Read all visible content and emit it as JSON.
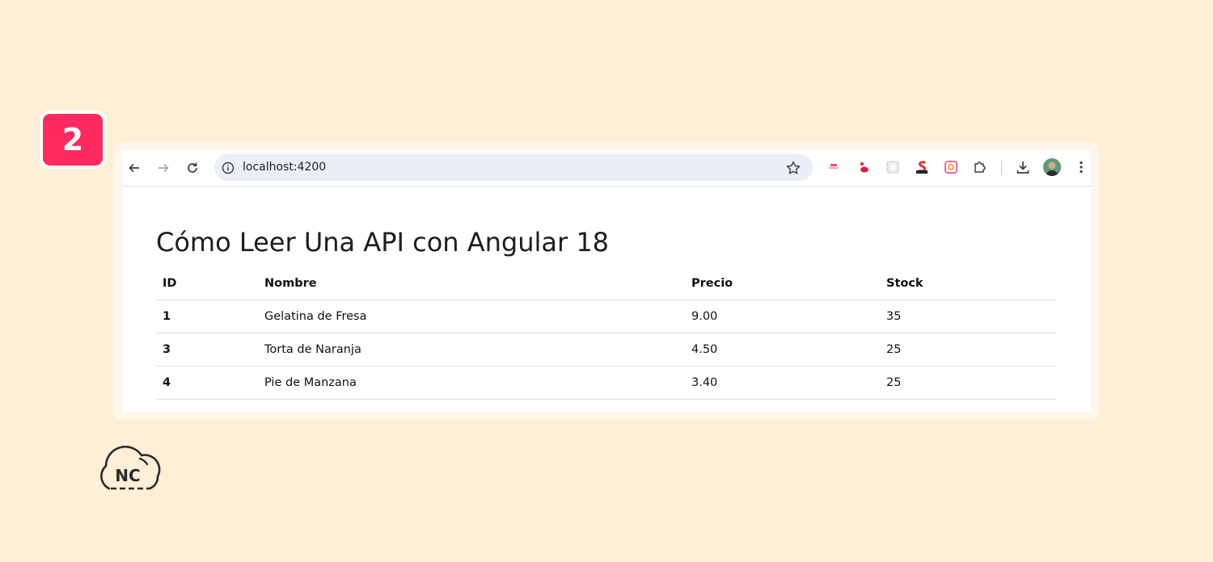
{
  "step_badge": {
    "number": "2",
    "color": "#ff2a5f"
  },
  "browser": {
    "address": "localhost:4200",
    "icons": {
      "back": "arrow-left-icon",
      "forward": "arrow-right-icon",
      "reload": "reload-icon",
      "site_info": "info-icon",
      "bookmark": "star-icon",
      "extensions_puzzle": "puzzle-icon",
      "download": "download-icon",
      "menu": "kebab-menu-icon"
    }
  },
  "page": {
    "title": "Cómo Leer Una API con Angular 18",
    "table": {
      "headers": [
        "ID",
        "Nombre",
        "Precio",
        "Stock"
      ],
      "rows": [
        {
          "id": "1",
          "nombre": "Gelatina de Fresa",
          "precio": "9.00",
          "stock": "35"
        },
        {
          "id": "3",
          "nombre": "Torta de Naranja",
          "precio": "4.50",
          "stock": "25"
        },
        {
          "id": "4",
          "nombre": "Pie de Manzana",
          "precio": "3.40",
          "stock": "25"
        }
      ]
    }
  },
  "logo": {
    "text": "NC"
  }
}
